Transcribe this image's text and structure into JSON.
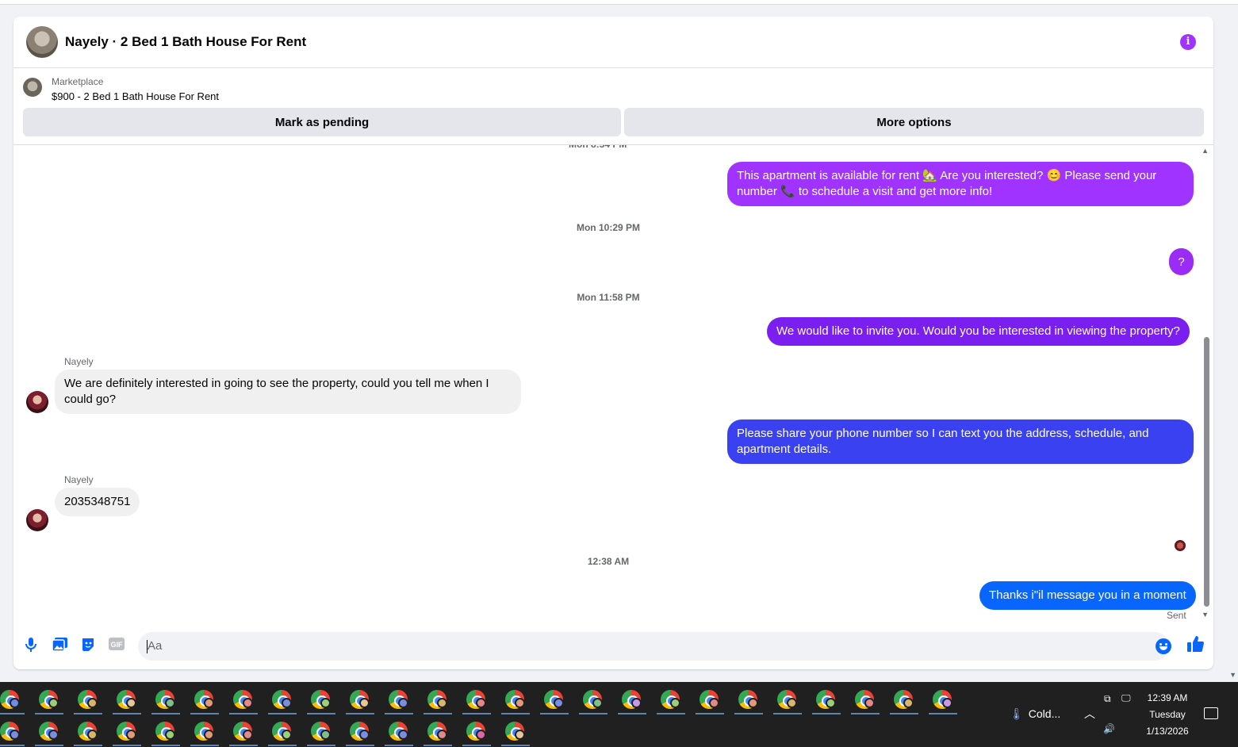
{
  "header": {
    "title": "Nayely · 2 Bed 1 Bath House For Rent"
  },
  "marketplace": {
    "label": "Marketplace",
    "listing": "$900 - 2 Bed 1 Bath House For Rent"
  },
  "actions": {
    "mark_pending": "Mark as pending",
    "more_options": "More options"
  },
  "messages": [
    {
      "type": "outgoing",
      "text": "This apartment is available for rent 🏡 Are you interested? 😊 Please send your number 📞 to schedule a visit and get more info!"
    },
    {
      "type": "timestamp",
      "text": "Mon 10:29 PM"
    },
    {
      "type": "outgoing",
      "text": "?"
    },
    {
      "type": "timestamp",
      "text": "Mon 11:58 PM"
    },
    {
      "type": "outgoing",
      "text": "We would like to invite you. Would you be interested in viewing the property?"
    },
    {
      "type": "incoming",
      "sender": "Nayely",
      "text": "We are definitely interested in going to see the property, could you tell me when I could go?"
    },
    {
      "type": "outgoing",
      "text": "Please share your phone number so I can text you the address, schedule, and apartment details."
    },
    {
      "type": "incoming",
      "sender": "Nayely",
      "text": "2035348751"
    },
    {
      "type": "timestamp",
      "text": "12:38 AM"
    },
    {
      "type": "outgoing",
      "text": "Thanks i\"il message you in a moment"
    }
  ],
  "status": {
    "sent": "Sent"
  },
  "composer": {
    "placeholder": "Aa",
    "gif": "GIF"
  },
  "taskbar": {
    "weather": "Cold...",
    "time": "12:39 AM",
    "day": "Tuesday",
    "date": "1/13/2026",
    "row1_profile_colors": [
      "#6b8de3",
      "#9ccf7a",
      "#d8b56c",
      "#e6c79a",
      "#7fbf8a",
      "#e39a7a",
      "#e08a8a",
      "#7a8ee0",
      "#9ccf7a",
      "#e6c79a",
      "#7a8ee0",
      "#d8b56c",
      "#e08a8a",
      "#e39a7a",
      "#7a8ee0",
      "#7fbf8a",
      "#c79ae6",
      "#9ccf7a",
      "#e08a8a",
      "#e39a7a",
      "#d8b56c",
      "#9ccf7a",
      "#e08a8a",
      "#d8b56c",
      "#c79ae6"
    ],
    "row2_profile_colors": [
      "#7a8ee0",
      "#7a8ee0",
      "#d8b56c",
      "#e39a7a",
      "#9ccf7a",
      "#e39a7a",
      "#e08a8a",
      "#9ccf7a",
      "#7fbf8a",
      "#7a8ee0",
      "#7a8ee0",
      "#e08a8a",
      "#d86aa6",
      "#e6c79a"
    ]
  },
  "colors": {
    "accent": "#0866ff",
    "purple": "#a033ff"
  }
}
